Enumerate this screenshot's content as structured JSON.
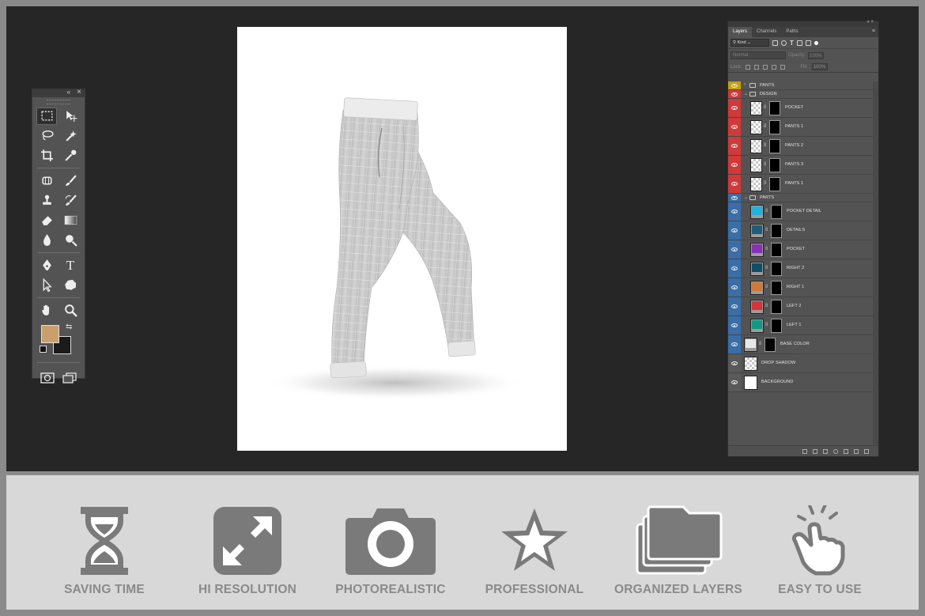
{
  "colors": {
    "workspace": "#262626",
    "panel": "#535353",
    "foreground_color": "#c9a06c",
    "background_color": "#1b1b1b",
    "feature_icon": "#7a7a7a",
    "feature_label": "#8a8a8a"
  },
  "tools_panel": {
    "collapse_icon": "«",
    "close_icon": "×",
    "tools": [
      [
        "rectangular-marquee-icon",
        "move-icon"
      ],
      [
        "lasso-icon",
        "magic-wand-icon"
      ],
      [
        "crop-icon",
        "eyedropper-icon"
      ],
      [
        "spot-healing-icon",
        "brush-icon"
      ],
      [
        "clone-stamp-icon",
        "history-brush-icon"
      ],
      [
        "eraser-icon",
        "gradient-icon"
      ],
      [
        "blur-icon",
        "dodge-icon"
      ],
      [
        "pen-icon",
        "type-icon"
      ],
      [
        "path-selection-icon",
        "custom-shape-icon"
      ],
      [
        "hand-icon",
        "zoom-icon"
      ]
    ],
    "type_glyph": "T"
  },
  "layers_panel": {
    "tabs": [
      "Layers",
      "Channels",
      "Paths"
    ],
    "active_tab": "Layers",
    "filter_kind": "Kind",
    "blend_mode": "Normal",
    "opacity_label": "Opacity:",
    "opacity_value": "100%",
    "lock_label": "Lock:",
    "fill_label": "Fill:",
    "fill_value": "100%",
    "layers": [
      {
        "name": "PANTS",
        "type": "group",
        "eye_color": "#c8a000",
        "collapsed": true,
        "indent": 0
      },
      {
        "name": "DESIGN",
        "type": "group",
        "eye_color": "#d03a3a",
        "collapsed": false,
        "indent": 0
      },
      {
        "name": "POCKET",
        "type": "smart",
        "eye_color": "#d03a3a",
        "indent": 1
      },
      {
        "name": "PANTS 1",
        "type": "smart",
        "eye_color": "#d03a3a",
        "indent": 1
      },
      {
        "name": "PANTS 2",
        "type": "smart",
        "eye_color": "#d03a3a",
        "indent": 1
      },
      {
        "name": "PANTS 3",
        "type": "smart",
        "eye_color": "#d03a3a",
        "indent": 1
      },
      {
        "name": "PANTS 1",
        "type": "smart",
        "eye_color": "#d03a3a",
        "indent": 1
      },
      {
        "name": "PARTS",
        "type": "group",
        "eye_color": "#3a6ea8",
        "collapsed": false,
        "indent": 0
      },
      {
        "name": "POCKET DETAIL",
        "type": "fill",
        "swatch": "#1fb3e0",
        "eye_color": "#3a6ea8",
        "indent": 1
      },
      {
        "name": "DETAILS",
        "type": "fill",
        "swatch": "#1e5c7a",
        "eye_color": "#3a6ea8",
        "indent": 1
      },
      {
        "name": "POCKET",
        "type": "fill",
        "swatch": "#8a2fb8",
        "eye_color": "#3a6ea8",
        "indent": 1
      },
      {
        "name": "RIGHT 2",
        "type": "fill",
        "swatch": "#0e4e66",
        "eye_color": "#3a6ea8",
        "indent": 1
      },
      {
        "name": "RIGHT 1",
        "type": "fill",
        "swatch": "#d07838",
        "eye_color": "#3a6ea8",
        "indent": 1
      },
      {
        "name": "LEFT 2",
        "type": "fill",
        "swatch": "#d8323a",
        "eye_color": "#3a6ea8",
        "indent": 1
      },
      {
        "name": "LEFT 1",
        "type": "fill",
        "swatch": "#0e9a86",
        "eye_color": "#3a6ea8",
        "indent": 1
      },
      {
        "name": "BASE COLOR",
        "type": "fill",
        "swatch": "#e8e8e8",
        "eye_color": "#3a6ea8",
        "indent": 0
      },
      {
        "name": "DROP SHADOW",
        "type": "raster",
        "eye_color": "#5a5a5a",
        "indent": 0
      },
      {
        "name": "BACKGROUND",
        "type": "white",
        "eye_color": "#5a5a5a",
        "indent": 0
      }
    ]
  },
  "features": [
    {
      "label": "SAVING TIME",
      "icon": "hourglass-icon"
    },
    {
      "label": "HI RESOLUTION",
      "icon": "expand-arrows-icon"
    },
    {
      "label": "PHOTOREALISTIC",
      "icon": "camera-icon"
    },
    {
      "label": "PROFESSIONAL",
      "icon": "star-icon"
    },
    {
      "label": "ORGANIZED LAYERS",
      "icon": "folders-icon"
    },
    {
      "label": "EASY TO USE",
      "icon": "tap-hand-icon"
    }
  ]
}
